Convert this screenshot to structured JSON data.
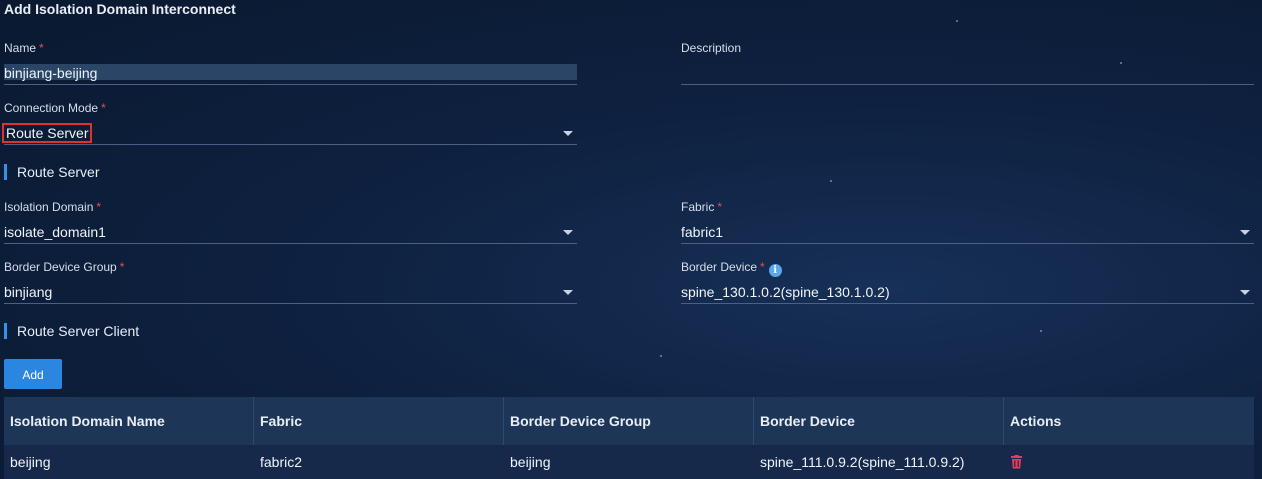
{
  "dialog": {
    "title": "Add Isolation Domain Interconnect"
  },
  "form": {
    "name": {
      "label": "Name",
      "value": "binjiang-beijing"
    },
    "description": {
      "label": "Description",
      "value": ""
    },
    "connection_mode": {
      "label": "Connection Mode",
      "value": "Route Server"
    },
    "isolation_domain": {
      "label": "Isolation Domain",
      "value": "isolate_domain1"
    },
    "fabric": {
      "label": "Fabric",
      "value": "fabric1"
    },
    "border_device_group": {
      "label": "Border Device Group",
      "value": "binjiang"
    },
    "border_device": {
      "label": "Border Device",
      "value": "spine_130.1.0.2(spine_130.1.0.2)"
    }
  },
  "required_mark": "*",
  "sections": {
    "route_server": "Route Server",
    "route_server_client": "Route Server Client"
  },
  "buttons": {
    "add": "Add"
  },
  "table": {
    "headers": [
      "Isolation Domain Name",
      "Fabric",
      "Border Device Group",
      "Border Device",
      "Actions"
    ],
    "rows": [
      [
        "beijing",
        "fabric2",
        "beijing",
        "spine_111.0.9.2(spine_111.0.9.2)"
      ]
    ]
  },
  "colors": {
    "accent": "#2b86e0",
    "required": "#e05050",
    "delete": "#e0405a",
    "highlight": "#e03030"
  },
  "icons": {
    "info": "info-icon",
    "delete": "trash-icon",
    "dropdown": "chevron-down-icon"
  }
}
